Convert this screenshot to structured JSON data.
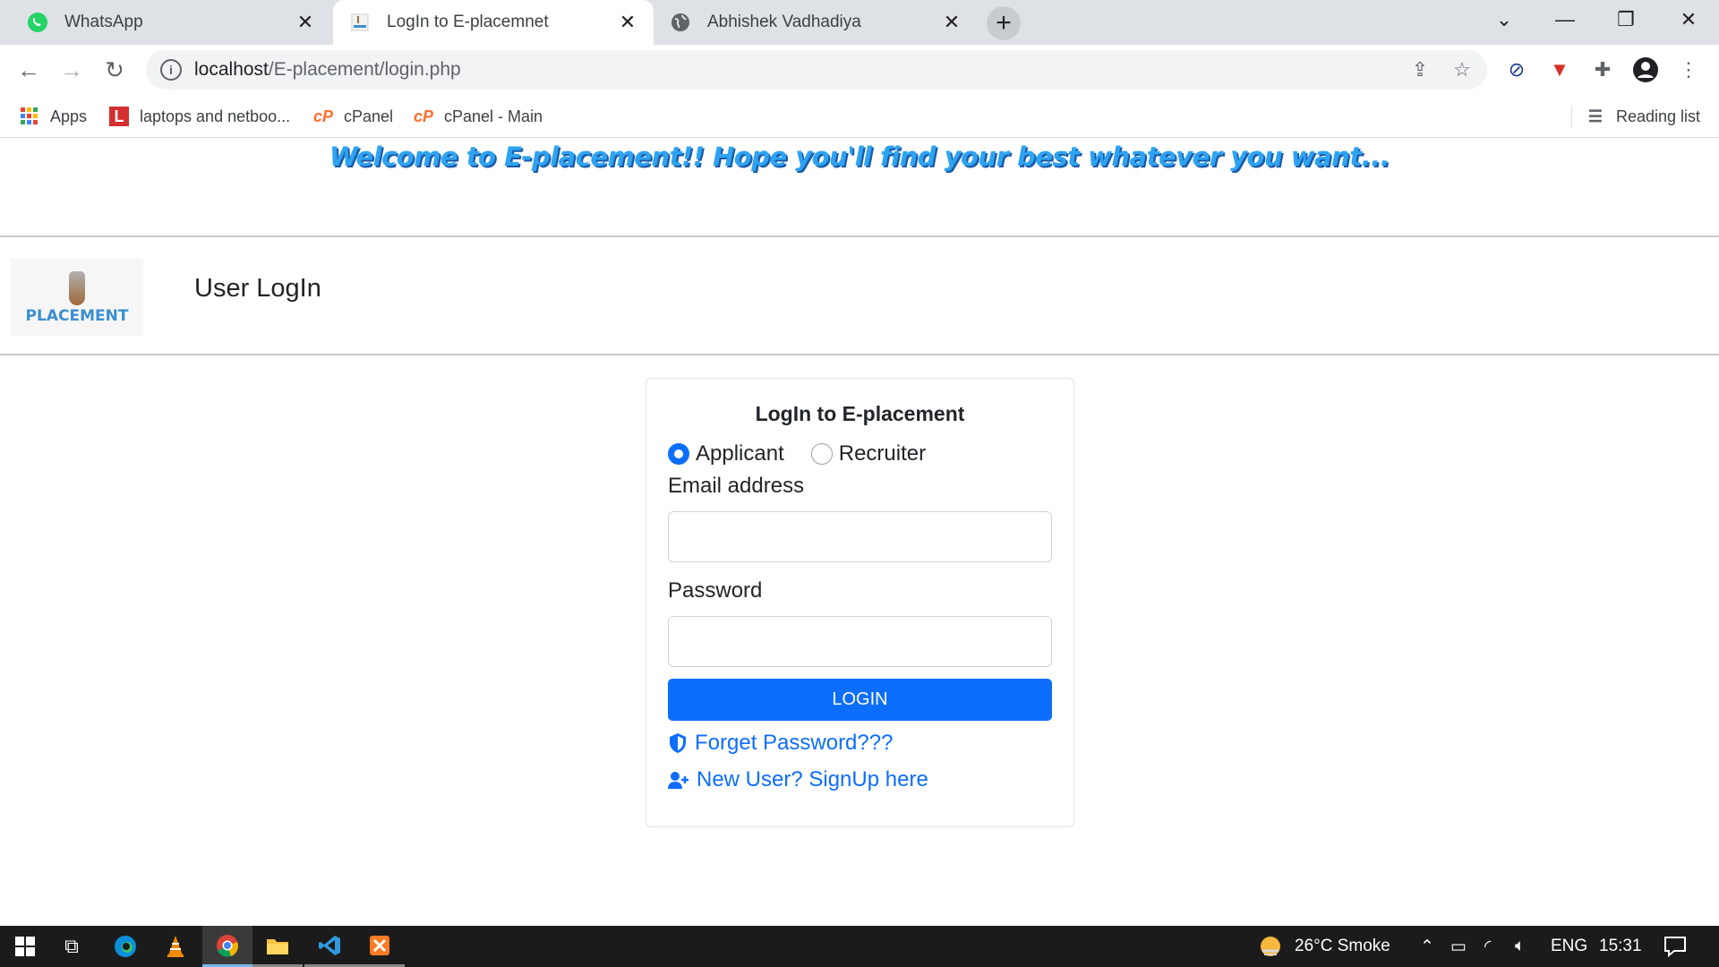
{
  "tabs": [
    {
      "title": "WhatsApp",
      "icon": "whatsapp-icon"
    },
    {
      "title": "LogIn to E-placemnet",
      "icon": "page-favicon"
    },
    {
      "title": "Abhishek Vadhadiya",
      "icon": "globe-icon"
    }
  ],
  "address_bar": {
    "host": "localhost",
    "path": "/E-placement/login.php"
  },
  "bookmarks": {
    "apps": "Apps",
    "items": [
      "laptops and netboo...",
      "cPanel",
      "cPanel - Main"
    ],
    "reading_list": "Reading list"
  },
  "page": {
    "welcome": "Welcome to E-placement!! Hope you'll find your best whatever you want...",
    "logo_text": "PLACEMENT",
    "section_title": "User LogIn",
    "form": {
      "title": "LogIn to E-placement",
      "role_applicant": "Applicant",
      "role_recruiter": "Recruiter",
      "email_label": "Email address",
      "password_label": "Password",
      "login_button": "LOGIN",
      "forgot_link": "Forget Password???",
      "signup_link": "New User? SignUp here"
    }
  },
  "taskbar": {
    "weather": "26°C  Smoke",
    "language": "ENG",
    "time": "15:31"
  },
  "colors": {
    "primary": "#0d6efd",
    "welcome": "#2ea3f2"
  }
}
